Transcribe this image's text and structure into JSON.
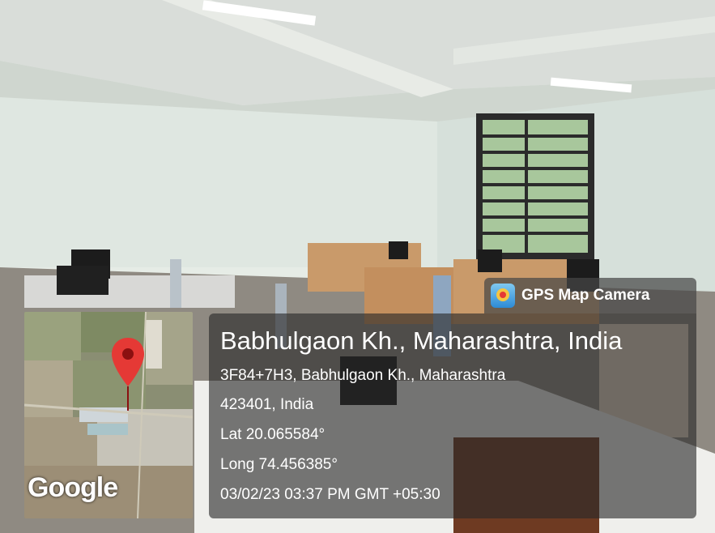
{
  "badge": {
    "label": "GPS Map Camera",
    "icon": "gps-camera-icon"
  },
  "location": {
    "title": "Babhulgaon Kh., Maharashtra, India",
    "address_line1": "3F84+7H3, Babhulgaon Kh., Maharashtra",
    "address_line2": "423401, India",
    "lat": "Lat 20.065584°",
    "long": "Long 74.456385°",
    "datetime": "03/02/23 03:37 PM GMT +05:30"
  },
  "map": {
    "attribution": "Google",
    "pin_color": "#e53935"
  }
}
